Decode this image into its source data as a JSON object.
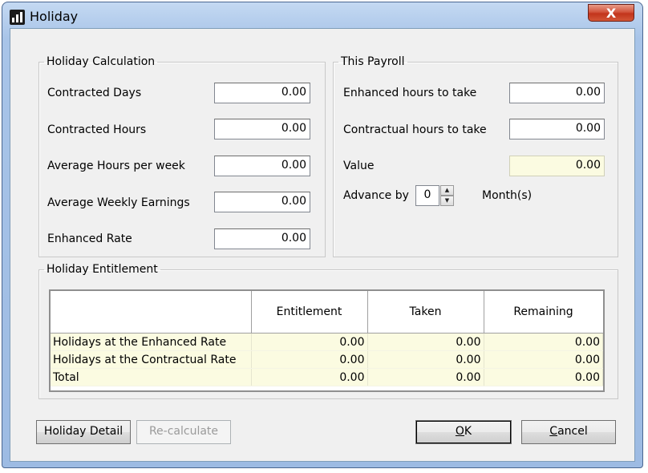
{
  "window": {
    "title": "Holiday",
    "close_label": "X"
  },
  "holiday_calc": {
    "legend": "Holiday Calculation",
    "fields": [
      {
        "label": "Contracted Days",
        "value": "0.00"
      },
      {
        "label": "Contracted Hours",
        "value": "0.00"
      },
      {
        "label": "Average Hours per week",
        "value": "0.00"
      },
      {
        "label": "Average Weekly Earnings",
        "value": "0.00"
      },
      {
        "label": "Enhanced Rate",
        "value": "0.00"
      }
    ]
  },
  "this_payroll": {
    "legend": "This Payroll",
    "fields": [
      {
        "label": "Enhanced hours to take",
        "value": "0.00"
      },
      {
        "label": "Contractual hours to take",
        "value": "0.00"
      },
      {
        "label": "Value",
        "value": "0.00"
      }
    ],
    "advance": {
      "label": "Advance by",
      "value": "0",
      "suffix": "Month(s)"
    }
  },
  "entitlement": {
    "legend": "Holiday Entitlement",
    "columns": [
      "",
      "Entitlement",
      "Taken",
      "Remaining"
    ],
    "rows": [
      [
        "Holidays at the Enhanced Rate",
        "0.00",
        "0.00",
        "0.00"
      ],
      [
        "Holidays at the Contractual Rate",
        "0.00",
        "0.00",
        "0.00"
      ],
      [
        "Total",
        "0.00",
        "0.00",
        "0.00"
      ]
    ]
  },
  "buttons": {
    "holiday_detail": "Holiday Detail",
    "recalculate": "Re-calculate",
    "ok_accel": "O",
    "ok_rest": "K",
    "cancel_accel": "C",
    "cancel_rest": "ancel"
  }
}
